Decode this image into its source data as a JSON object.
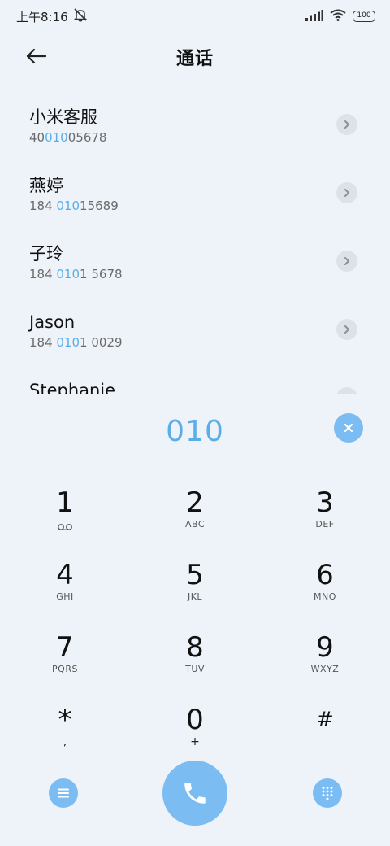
{
  "status_bar": {
    "time": "上午8:16",
    "battery": "100",
    "icons": [
      "mute-icon",
      "signal-icon",
      "wifi-icon",
      "battery-icon"
    ]
  },
  "header": {
    "title": "通话",
    "back_icon": "back-arrow-icon"
  },
  "contacts": [
    {
      "name": "小米客服",
      "number_pre": "40",
      "number_hl": "010",
      "number_post": "05678"
    },
    {
      "name": "燕婷",
      "number_pre": "184 ",
      "number_hl": "010",
      "number_post": "15689"
    },
    {
      "name": "子玲",
      "number_pre": "184 ",
      "number_hl": "010",
      "number_post": "1 5678"
    },
    {
      "name": "Jason",
      "number_pre": "184 ",
      "number_hl": "010",
      "number_post": "1 0029"
    },
    {
      "name": "Stephanie",
      "number_pre": "",
      "number_hl": "",
      "number_post": ""
    }
  ],
  "dial": {
    "number": "010"
  },
  "keypad": [
    {
      "digit": "1",
      "letters": ""
    },
    {
      "digit": "2",
      "letters": "ABC"
    },
    {
      "digit": "3",
      "letters": "DEF"
    },
    {
      "digit": "4",
      "letters": "GHI"
    },
    {
      "digit": "5",
      "letters": "JKL"
    },
    {
      "digit": "6",
      "letters": "MNO"
    },
    {
      "digit": "7",
      "letters": "PQRS"
    },
    {
      "digit": "8",
      "letters": "TUV"
    },
    {
      "digit": "9",
      "letters": "WXYZ"
    },
    {
      "digit": "*",
      "letters": ","
    },
    {
      "digit": "0",
      "letters": "+"
    },
    {
      "digit": "#",
      "letters": ""
    }
  ],
  "colors": {
    "accent": "#7bbcf2",
    "highlight": "#5aaee8",
    "background": "#eef3f9"
  }
}
